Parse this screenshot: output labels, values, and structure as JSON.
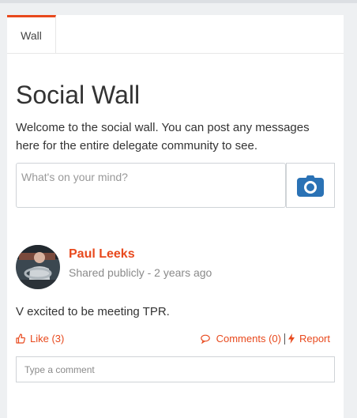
{
  "tabs": [
    {
      "label": "Wall"
    }
  ],
  "page": {
    "title": "Social Wall",
    "intro": "Welcome to the social wall. You can post any messages here for the entire delegate community to see."
  },
  "composer": {
    "placeholder": "What's on your mind?",
    "camera_icon": "camera-icon"
  },
  "post": {
    "author": "Paul Leeks",
    "meta": "Shared publicly - 2 years ago",
    "text": "V excited to be meeting TPR.",
    "like_label": "Like (3)",
    "comments_label": "Comments (0)",
    "report_label": "Report",
    "comment_placeholder": "Type a comment"
  },
  "colors": {
    "accent": "#e8491d",
    "camera": "#2a72b5",
    "background": "#eef0f2"
  }
}
